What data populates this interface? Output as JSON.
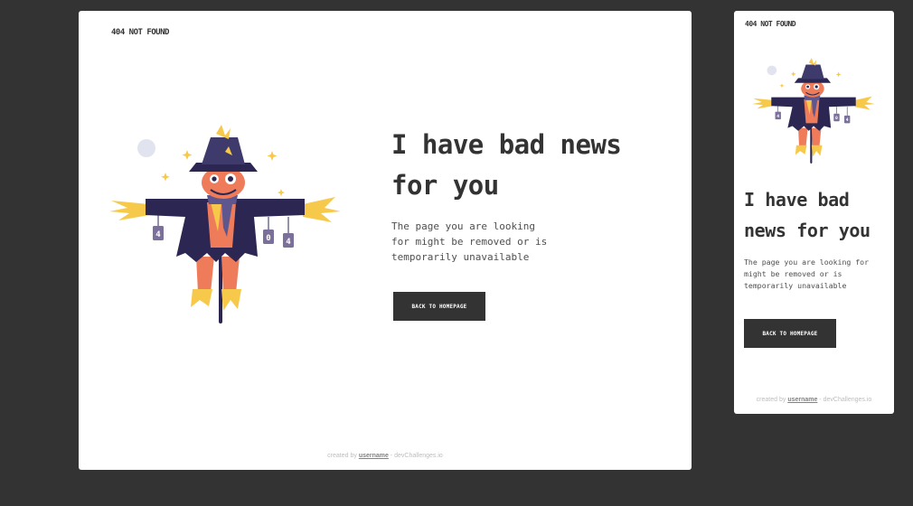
{
  "brand": "404 NOT FOUND",
  "headline": {
    "desktop_line1": "I have bad news",
    "desktop_line2": "for you",
    "mobile_line1": "I have bad",
    "mobile_line2": "news for you"
  },
  "description": {
    "desktop_line1": "The page you are looking",
    "desktop_line2": "for might be removed or is",
    "desktop_line3": "temporarily unavailable",
    "mobile_line1": "The page you are looking for",
    "mobile_line2": "might be removed or is",
    "mobile_line3": "temporarily unavailable"
  },
  "cta_label": "BACK TO HOMEPAGE",
  "footer": {
    "prefix": "created by ",
    "username": "username",
    "suffix": " - devChallenges.io"
  },
  "can_labels": [
    "4",
    "0",
    "4"
  ],
  "colors": {
    "page_bg": "#333333",
    "card_bg": "#ffffff",
    "text": "#333333",
    "button_bg": "#333333",
    "button_text": "#ffffff",
    "hat": "#3e3a6b",
    "coat": "#2b2752",
    "skin": "#ee7c5a",
    "straw": "#f7c94b",
    "can": "#7a7099"
  }
}
